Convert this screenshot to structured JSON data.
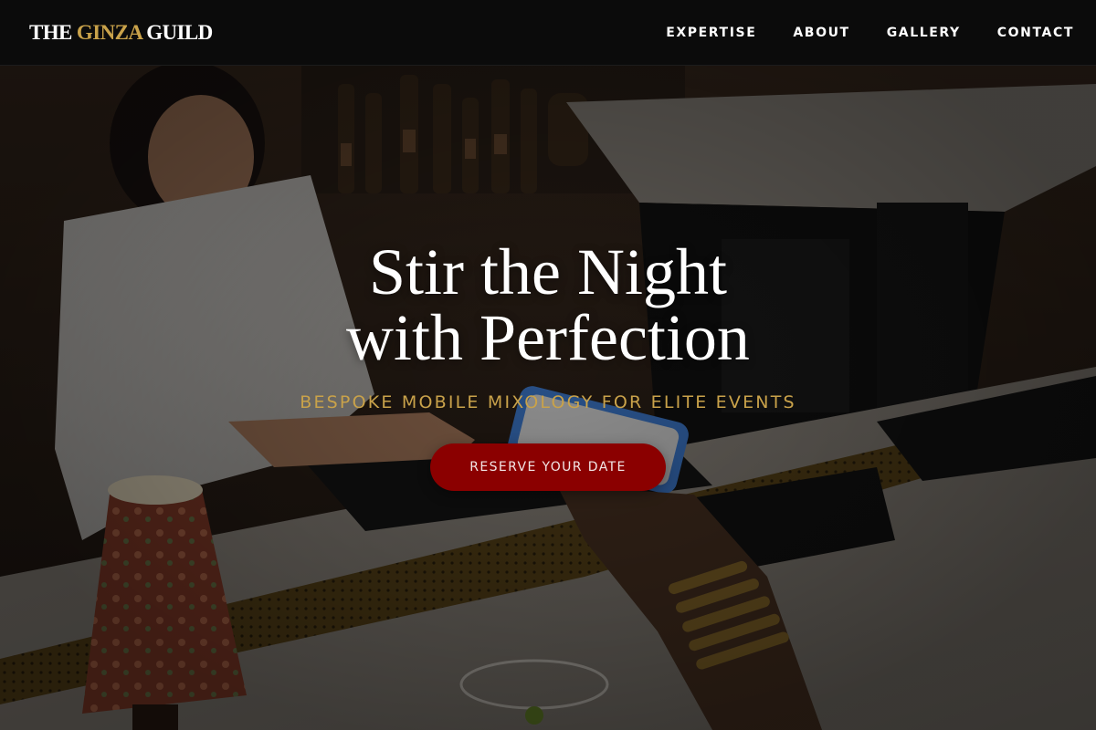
{
  "header": {
    "logo": {
      "part1": "THE ",
      "accent": "GINZA",
      "part2": " GUILD"
    },
    "nav": [
      {
        "label": "EXPERTISE"
      },
      {
        "label": "ABOUT"
      },
      {
        "label": "GALLERY"
      },
      {
        "label": "CONTACT"
      }
    ]
  },
  "hero": {
    "title_line1": "Stir the Night",
    "title_line2": "with Perfection",
    "subtitle": "BESPOKE MOBILE MIXOLOGY FOR ELITE EVENTS",
    "cta_label": "RESERVE YOUR DATE",
    "background_image": "bartender-serving-guest-photo"
  },
  "colors": {
    "header_bg": "#0b0b0b",
    "accent_gold": "#c9a24a",
    "cta_red": "#8b0000",
    "text_white": "#ffffff"
  }
}
